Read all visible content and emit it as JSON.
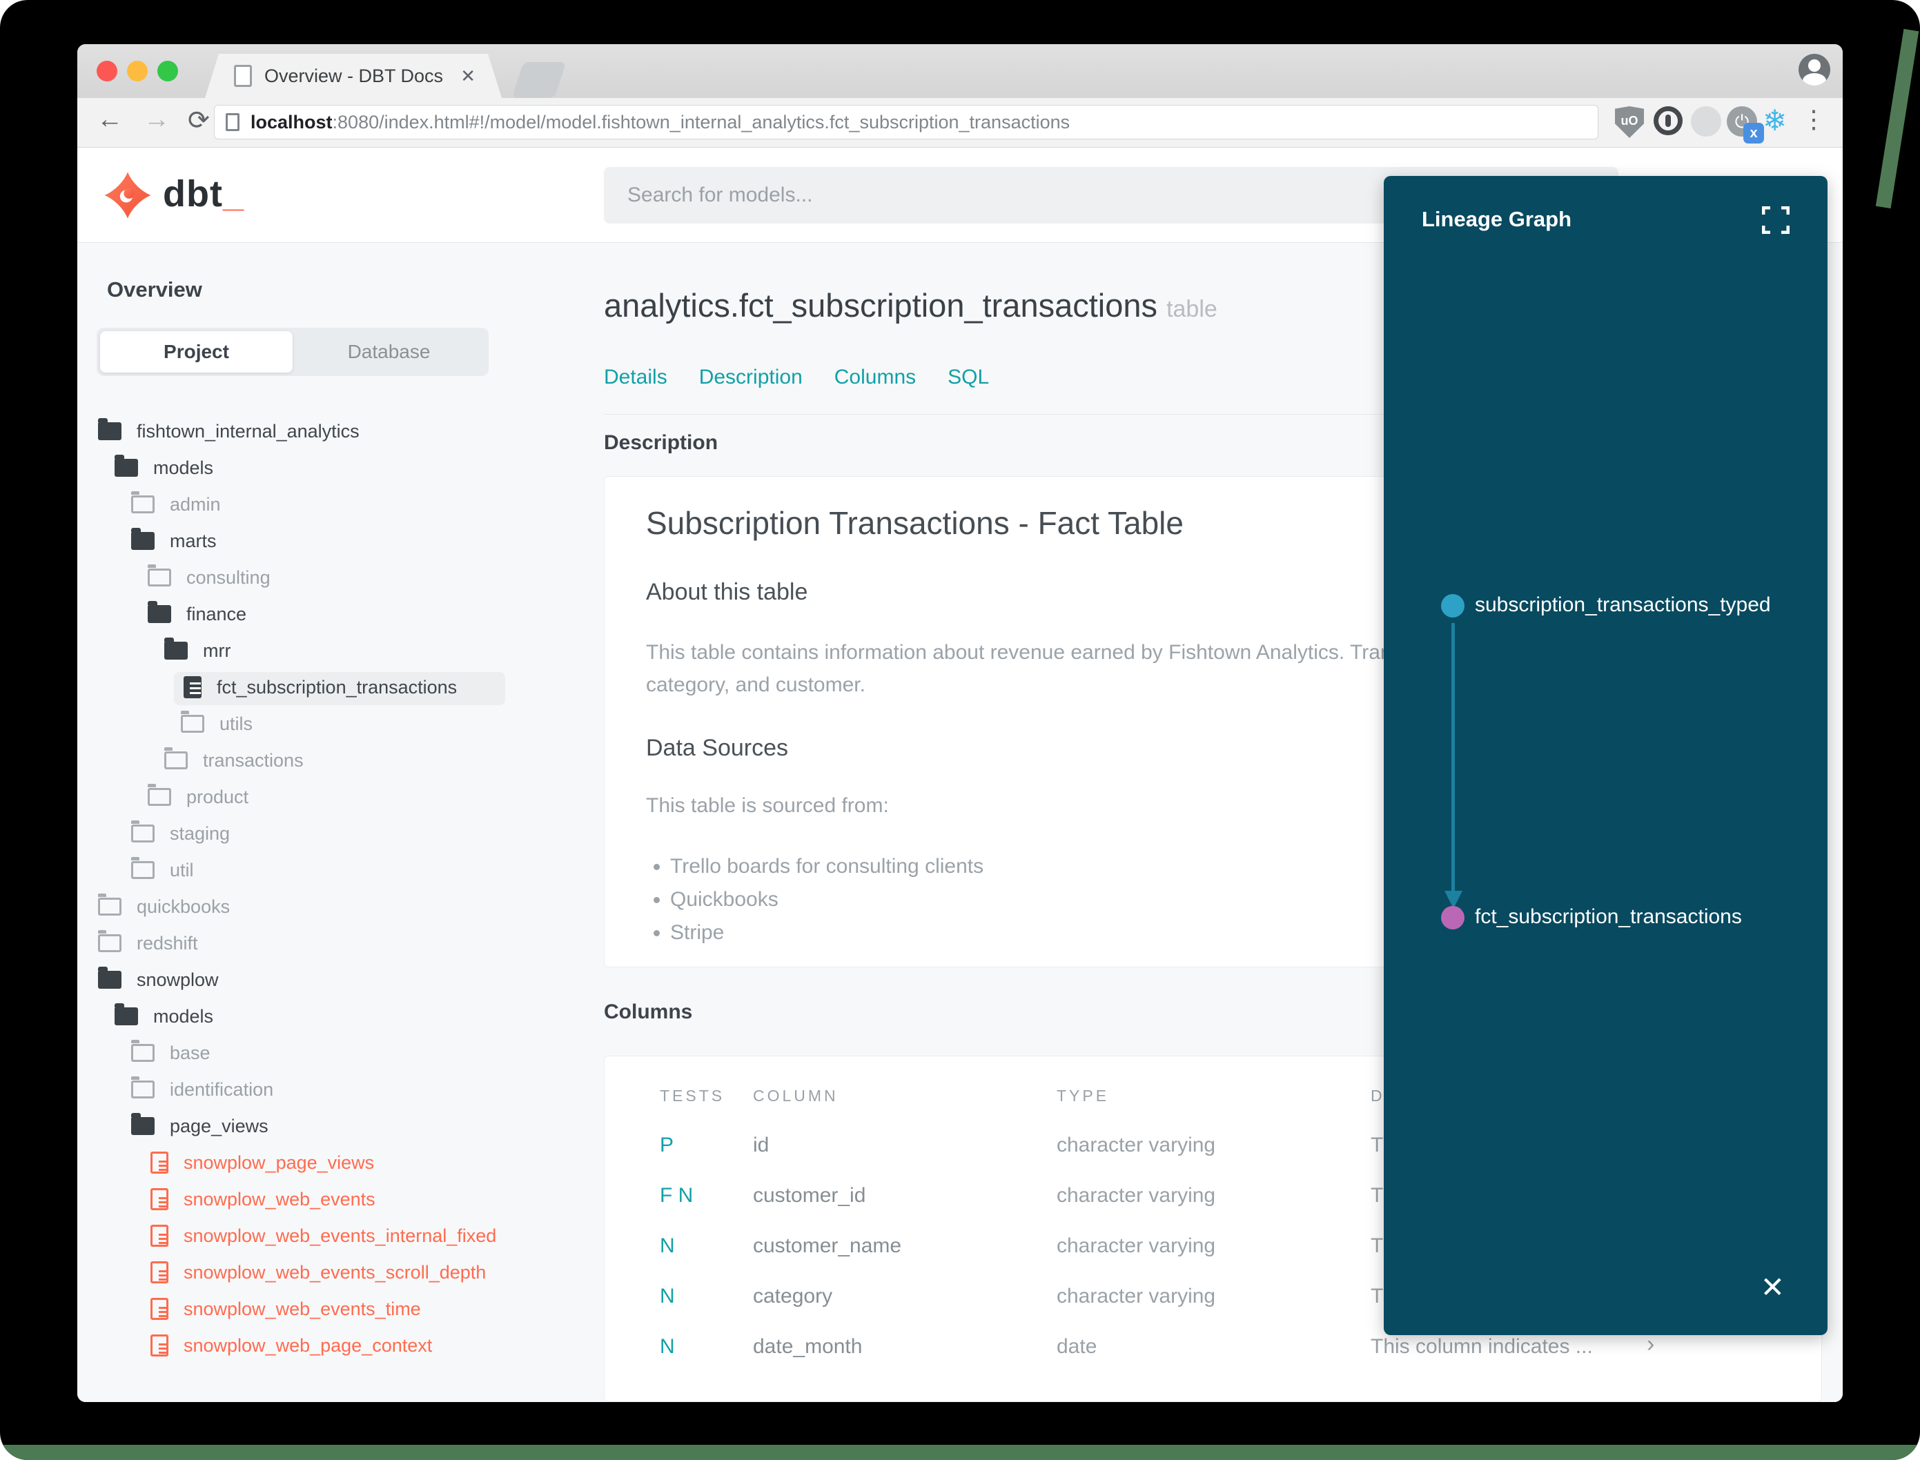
{
  "browser": {
    "tab_title": "Overview - DBT Docs",
    "close_tab": "✕",
    "url_host": "localhost",
    "url_path": ":8080/index.html#!/model/model.fishtown_internal_analytics.fct_subscription_transactions",
    "back_glyph": "←",
    "forward_glyph": "→",
    "reload_glyph": "⟳",
    "ublock_label": "uO",
    "power_glyph": "⏻",
    "badge_x": "x",
    "snowflake_glyph": "❄",
    "menu_glyph": "⋮"
  },
  "header": {
    "logo_text": "dbt",
    "logo_underscore": "_",
    "search_placeholder": "Search for models..."
  },
  "sidebar": {
    "overview_label": "Overview",
    "tabs": {
      "project": "Project",
      "database": "Database"
    },
    "tree": [
      {
        "label": "fishtown_internal_analytics",
        "level": 0,
        "icon": "folder-open"
      },
      {
        "label": "models",
        "level": 1,
        "icon": "folder-open"
      },
      {
        "label": "admin",
        "level": 2,
        "icon": "folder-closed"
      },
      {
        "label": "marts",
        "level": 2,
        "icon": "folder-open"
      },
      {
        "label": "consulting",
        "level": 3,
        "icon": "folder-closed"
      },
      {
        "label": "finance",
        "level": 3,
        "icon": "folder-open"
      },
      {
        "label": "mrr",
        "level": 4,
        "icon": "folder-open"
      },
      {
        "label": "fct_subscription_transactions",
        "level": 5,
        "icon": "file-dark",
        "selected": true
      },
      {
        "label": "utils",
        "level": 5,
        "icon": "folder-closed"
      },
      {
        "label": "transactions",
        "level": 4,
        "icon": "folder-closed"
      },
      {
        "label": "product",
        "level": 3,
        "icon": "folder-closed"
      },
      {
        "label": "staging",
        "level": 2,
        "icon": "folder-closed"
      },
      {
        "label": "util",
        "level": 2,
        "icon": "folder-closed"
      },
      {
        "label": "quickbooks",
        "level": 0,
        "icon": "folder-closed"
      },
      {
        "label": "redshift",
        "level": 0,
        "icon": "folder-closed"
      },
      {
        "label": "snowplow",
        "level": 0,
        "icon": "folder-open"
      },
      {
        "label": "models",
        "level": 1,
        "icon": "folder-open"
      },
      {
        "label": "base",
        "level": 2,
        "icon": "folder-closed"
      },
      {
        "label": "identification",
        "level": 2,
        "icon": "folder-closed"
      },
      {
        "label": "page_views",
        "level": 2,
        "icon": "folder-open"
      },
      {
        "label": "snowplow_page_views",
        "level": 3,
        "icon": "file-red"
      },
      {
        "label": "snowplow_web_events",
        "level": 3,
        "icon": "file-red"
      },
      {
        "label": "snowplow_web_events_internal_fixed",
        "level": 3,
        "icon": "file-red"
      },
      {
        "label": "snowplow_web_events_scroll_depth",
        "level": 3,
        "icon": "file-red"
      },
      {
        "label": "snowplow_web_events_time",
        "level": 3,
        "icon": "file-red"
      },
      {
        "label": "snowplow_web_page_context",
        "level": 3,
        "icon": "file-red"
      }
    ]
  },
  "main": {
    "title": "analytics.fct_subscription_transactions",
    "title_suffix": "table",
    "nav": [
      "Details",
      "Description",
      "Columns",
      "SQL"
    ],
    "description": {
      "section_heading": "Description",
      "card_title": "Subscription Transactions - Fact Table",
      "about_heading": "About this table",
      "about_line1": "This table contains information about revenue earned by Fishtown Analytics. Trans",
      "about_line2": "category, and customer.",
      "sources_heading": "Data Sources",
      "sources_intro": "This table is sourced from:",
      "sources": [
        "Trello boards for consulting clients",
        "Quickbooks",
        "Stripe"
      ]
    },
    "columns": {
      "section_heading": "Columns",
      "headers": [
        "TESTS",
        "COLUMN",
        "TYPE",
        "DESCRIPTION"
      ],
      "rows": [
        {
          "tests": "P",
          "column": "id",
          "type": "character varying",
          "description": "T"
        },
        {
          "tests": "F N",
          "column": "customer_id",
          "type": "character varying",
          "description": "T"
        },
        {
          "tests": "N",
          "column": "customer_name",
          "type": "character varying",
          "description": "T"
        },
        {
          "tests": "N",
          "column": "category",
          "type": "character varying",
          "description": "T"
        },
        {
          "tests": "N",
          "column": "date_month",
          "type": "date",
          "description": "This column indicates ...",
          "chevron": "›"
        }
      ]
    }
  },
  "lineage": {
    "title": "Lineage Graph",
    "close": "✕",
    "nodes": [
      {
        "label": "subscription_transactions_typed",
        "color": "#2ea1c6"
      },
      {
        "label": "fct_subscription_transactions",
        "color": "#ba68b5"
      }
    ]
  },
  "colors": {
    "accent_teal": "#13a0a8",
    "brand_orange": "#ff6b4f",
    "lineage_panel_bg": "#084a60",
    "lineage_edge": "#1d81a0",
    "node_source": "#2ea1c6",
    "node_target": "#ba68b5",
    "error_file_red": "#ff6b4f"
  }
}
